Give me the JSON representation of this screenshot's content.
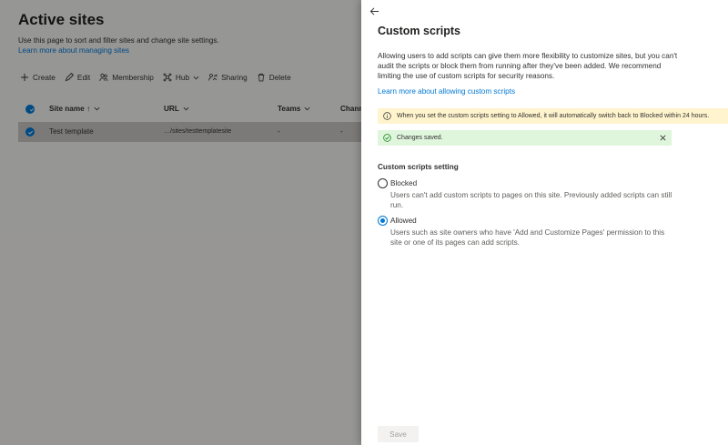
{
  "background": {
    "title": "Active sites",
    "description": "Use this page to sort and filter sites and change site settings.",
    "link": "Learn more about managing sites",
    "commands": [
      {
        "label": "Create",
        "icon": "plus-icon"
      },
      {
        "label": "Edit",
        "icon": "pencil-icon"
      },
      {
        "label": "Membership",
        "icon": "people-icon"
      },
      {
        "label": "Hub",
        "icon": "hub-icon"
      },
      {
        "label": "Sharing",
        "icon": "share-icon"
      },
      {
        "label": "Delete",
        "icon": "trash-icon"
      }
    ],
    "columns": {
      "site_name": "Site name",
      "sort_indicator": "↑",
      "url": "URL",
      "teams": "Teams",
      "channels": "Chann"
    },
    "row": {
      "site_name": "Test template",
      "url": "…/sites/testtemplatesite",
      "teams": "-",
      "channels": "-"
    }
  },
  "panel": {
    "title": "Custom scripts",
    "description": "Allowing users to add scripts can give them more flexibility to customize sites, but you can't audit the scripts or block them from running after they've been added. We recommend limiting the use of custom scripts for security reasons.",
    "link": "Learn more about allowing custom scripts",
    "warning": "When you set the custom scripts setting to Allowed, it will automatically switch back to Blocked within 24 hours.",
    "success": "Changes saved.",
    "setting_label": "Custom scripts setting",
    "options": [
      {
        "label": "Blocked",
        "description": "Users can't add custom scripts to pages on this site. Previously added scripts can still run.",
        "selected": false
      },
      {
        "label": "Allowed",
        "description": "Users such as site owners who have 'Add and Customize Pages' permission to this site or one of its pages can add scripts.",
        "selected": true
      }
    ],
    "save_label": "Save"
  },
  "colors": {
    "accent": "#0078d4",
    "warning_bg": "#fff4ce",
    "success_bg": "#dff6dd",
    "success_icon": "#107c10"
  }
}
